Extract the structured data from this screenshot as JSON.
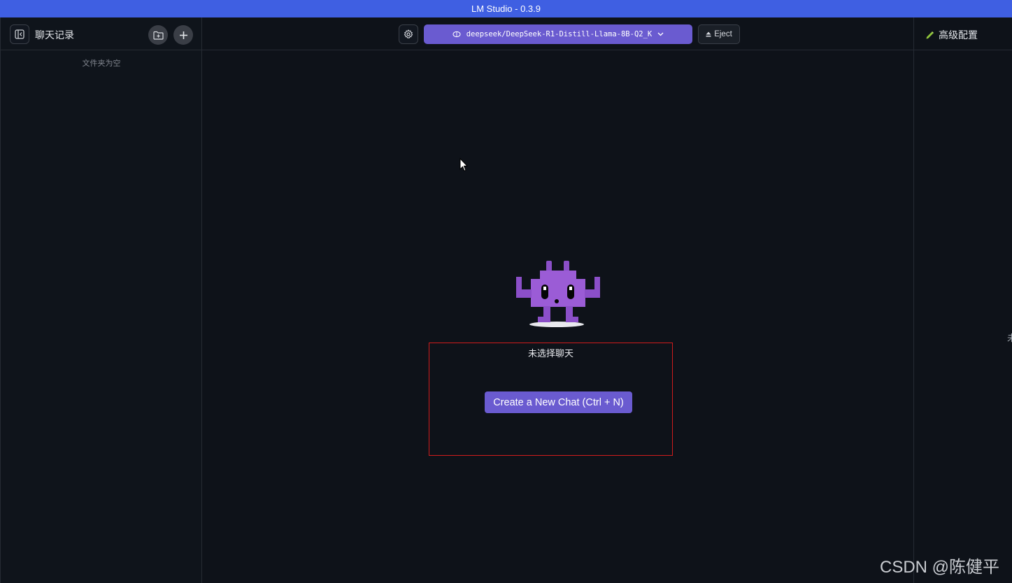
{
  "window": {
    "title": "LM Studio - 0.3.9"
  },
  "sidebar": {
    "title": "聊天记录",
    "empty_text": "文件夹为空",
    "toggle_icon": "sidebar-toggle-icon",
    "new_folder_icon": "folder-plus-icon",
    "new_chat_icon": "plus-icon"
  },
  "toolbar": {
    "model_label": "deepseek/DeepSeek-R1-Distill-Llama-8B-Q2_K",
    "eject_label": "Eject",
    "model_button_color": "#6a5bd0"
  },
  "right_panel": {
    "title": "高级配置",
    "clipped_text": "未"
  },
  "main": {
    "empty_title": "未选择聊天",
    "new_chat_button": "Create a New Chat (Ctrl + N)",
    "mascot_color": "#8b4fc8"
  },
  "watermark": "CSDN @陈健平",
  "colors": {
    "titlebar": "#3f5fe2",
    "background": "#0e1219",
    "accent": "#6a5bd0",
    "highlight_border": "#d01c1c"
  }
}
